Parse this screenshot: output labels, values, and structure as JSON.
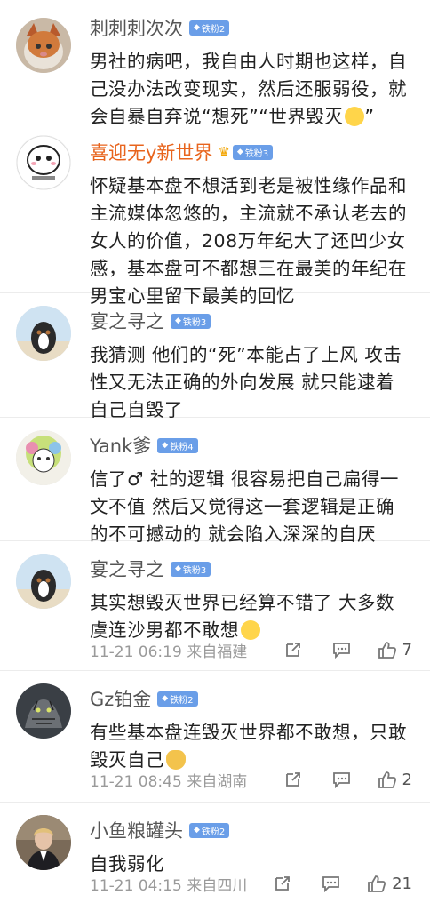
{
  "comments": [
    {
      "username": "刺刺刺次次",
      "badge": "铁粉2",
      "text": "男社的病吧，我自由人时期也这样，自己没办法改变现实，然后还服弱役，就会自暴自弃说“想死”“世界毁灭",
      "text_tail": "”"
    },
    {
      "username": "喜迎无y新世界",
      "badge": "铁粉3",
      "text": "怀疑基本盘不想活到老是被性缘作品和主流媒体忽悠的，主流就不承认老去的女人的价值，208万年纪大了还凹少女感，基本盘可不都想三在最美的年纪在男宝心里留下最美的回忆"
    },
    {
      "username": "宴之寻之",
      "badge": "铁粉3",
      "text": "我猜测 他们的“死”本能占了上风 攻击性又无法正确的外向发展 就只能逮着自己自毁了"
    },
    {
      "username": "Yank爹",
      "badge": "铁粉4",
      "text": "信了♂ 社的逻辑 很容易把自己扁得一文不值 然后又觉得这一套逻辑是正确的不可撼动的 就会陷入深深的自厌"
    },
    {
      "username": "宴之寻之",
      "badge": "铁粉3",
      "text": "其实想毁灭世界已经算不错了 大多数虞连沙男都不敢想",
      "time": "11-21 06:19",
      "location": "来自福建",
      "likes": "7"
    },
    {
      "username": "Gz铂金",
      "badge": "铁粉2",
      "text": "有些基本盘连毁灭世界都不敢想，只敢毁灭自己",
      "time": "11-21 08:45",
      "location": "来自湖南",
      "likes": "2"
    },
    {
      "username": "小鱼粮罐头",
      "badge": "铁粉2",
      "text": "自我弱化",
      "time": "11-21 04:15",
      "location": "来自四川",
      "likes": "21"
    }
  ],
  "colors": {
    "vip_name": "#e8641d",
    "badge_blue": "#6a9ee8",
    "badge_gold": "#f0b43a"
  },
  "icons": {
    "share": "share-icon",
    "reply": "comment-icon",
    "like": "thumb-up-icon"
  }
}
